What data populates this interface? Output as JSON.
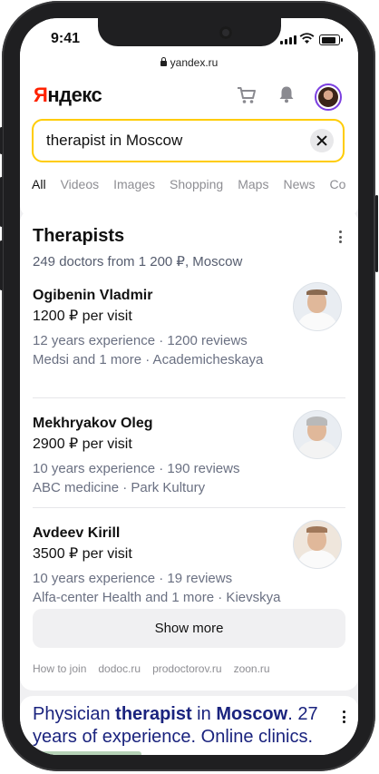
{
  "status_bar": {
    "time": "9:41"
  },
  "browser": {
    "url": "yandex.ru"
  },
  "header": {
    "logo_first": "Я",
    "logo_rest": "ндекс",
    "search": {
      "value": "therapist in Moscow"
    },
    "tabs": [
      {
        "label": "All",
        "active": true
      },
      {
        "label": "Videos"
      },
      {
        "label": "Images"
      },
      {
        "label": "Shopping"
      },
      {
        "label": "Maps"
      },
      {
        "label": "News"
      },
      {
        "label": "Co"
      }
    ]
  },
  "therapists_card": {
    "title": "Therapists",
    "subtitle": "249 doctors from 1 200 ₽, Moscow",
    "doctors": [
      {
        "name": "Ogibenin Vladmir",
        "price": "1200 ₽ per visit",
        "line1": "12 years experience · 1200 reviews",
        "line2": "Medsi and 1 more · Academicheskaya"
      },
      {
        "name": "Mekhryakov Oleg",
        "price": "2900 ₽ per visit",
        "line1": "10 years experience · 190 reviews",
        "line2": "ABC medicine · Park Kultury"
      },
      {
        "name": "Avdeev Kirill",
        "price": "3500 ₽ per visit",
        "line1": "10 years experience · 19 reviews",
        "line2": "Alfa-center Health and 1 more · Kievskya"
      }
    ],
    "show_more_label": "Show more",
    "footer_links": [
      "How to join",
      "dodoc.ru",
      "prodoctorov.ru",
      "zoon.ru"
    ]
  },
  "search_result": {
    "title_part1": "Physician ",
    "title_bold1": "therapist",
    "title_part2": " in ",
    "title_bold2": "Moscow",
    "title_part3": ". 27 years of experience. Online clinics."
  },
  "colors": {
    "accent_yellow": "#ffcc00",
    "logo_red": "#ff2200",
    "link_blue": "#1a237e"
  }
}
